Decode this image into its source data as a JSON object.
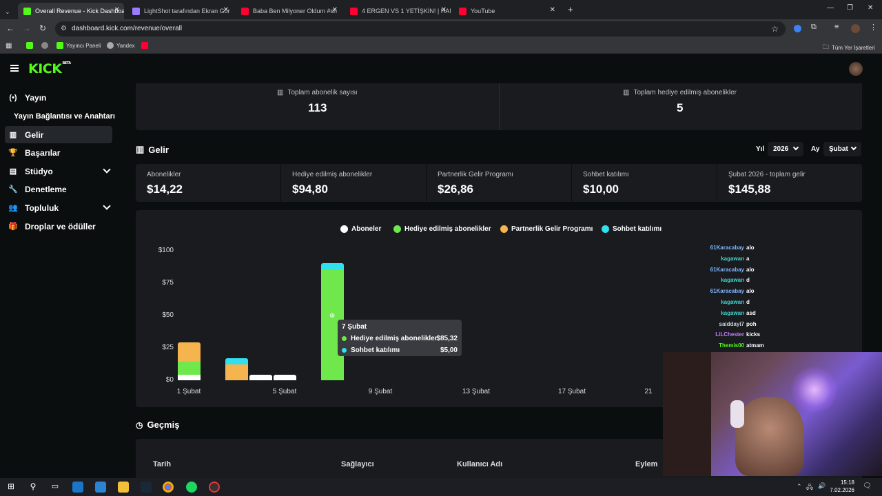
{
  "browser": {
    "tabs": [
      {
        "title": "Overall Revenue - Kick Dashboa",
        "active": true
      },
      {
        "title": "LightShot tarafından Ekran Gör",
        "active": false
      },
      {
        "title": "Baba Ben Milyoner Oldum #sh",
        "active": false
      },
      {
        "title": "4 ERGEN VS 1 YETİŞKİN! | HANİ",
        "active": false
      },
      {
        "title": "YouTube",
        "active": false
      }
    ],
    "url": "dashboard.kick.com/revenue/overall",
    "bookmarks": [
      "Yayıncı Paneli",
      "Yandex"
    ],
    "all_bookmarks_label": "Tüm Yer İşaretleri"
  },
  "sidebar": {
    "items": [
      {
        "label": "Yayın",
        "icon": "broadcast-icon"
      },
      {
        "label": "Yayın Bağlantısı ve Anahtarı",
        "icon": ""
      },
      {
        "label": "Gelir",
        "icon": "chart-icon",
        "active": true
      },
      {
        "label": "Başarılar",
        "icon": "trophy-icon"
      },
      {
        "label": "Stüdyo",
        "icon": "studio-icon",
        "expandable": true
      },
      {
        "label": "Denetleme",
        "icon": "wrench-icon"
      },
      {
        "label": "Topluluk",
        "icon": "people-icon",
        "expandable": true
      },
      {
        "label": "Droplar ve ödüller",
        "icon": "gift-icon"
      }
    ]
  },
  "summary": {
    "total_subs_label": "Toplam abonelik sayısı",
    "total_subs_value": "113",
    "total_gifted_label": "Toplam hediye edilmiş abonelikler",
    "total_gifted_value": "5"
  },
  "revenue": {
    "title": "Gelir",
    "year_label": "Yıl",
    "year_value": "2026",
    "month_label": "Ay",
    "month_value": "Şubat",
    "kpis": [
      {
        "label": "Abonelikler",
        "value": "$14,22"
      },
      {
        "label": "Hediye edilmiş abonelikler",
        "value": "$94,80"
      },
      {
        "label": "Partnerlik Gelir Programı",
        "value": "$26,86"
      },
      {
        "label": "Sohbet katılımı",
        "value": "$10,00"
      },
      {
        "label": "Şubat 2026 - toplam gelir",
        "value": "$145,88"
      }
    ]
  },
  "chart_data": {
    "type": "bar",
    "stacked": true,
    "y_ticks": [
      "$100",
      "$75",
      "$50",
      "$25",
      "$0"
    ],
    "ylim": [
      0,
      100
    ],
    "x_tick_labels": [
      "1 Şubat",
      "5 Şubat",
      "9 Şubat",
      "13 Şubat",
      "17 Şubat",
      "21"
    ],
    "categories": [
      "1 Şubat",
      "3 Şubat",
      "4 Şubat",
      "5 Şubat",
      "7 Şubat"
    ],
    "series": [
      {
        "name": "Aboneler",
        "color": "#ffffff",
        "values": [
          4.5,
          0,
          4.5,
          4.5,
          0
        ]
      },
      {
        "name": "Hediye edilmiş abonelikler",
        "color": "#6ee84a",
        "values": [
          10,
          0,
          0,
          0,
          85.32
        ]
      },
      {
        "name": "Partnerlik Gelir Programı",
        "color": "#f5b44d",
        "values": [
          15,
          12,
          0,
          0,
          0
        ]
      },
      {
        "name": "Sohbet katılımı",
        "color": "#31e0ee",
        "values": [
          0,
          5,
          0,
          0,
          5.0
        ]
      }
    ],
    "tooltip": {
      "title": "7 Şubat",
      "rows": [
        {
          "label": "Hediye edilmiş abonelikler",
          "value": "$85,32"
        },
        {
          "label": "Sohbet katılımı",
          "value": "$5,00"
        }
      ]
    }
  },
  "chat_overlay": [
    {
      "user": "61Karacabay",
      "msg": "alo",
      "color": "#7fb5ff"
    },
    {
      "user": "kagawan",
      "msg": "a",
      "color": "#3fd6d0"
    },
    {
      "user": "61Karacabay",
      "msg": "alo",
      "color": "#7fb5ff"
    },
    {
      "user": "kagawan",
      "msg": "d",
      "color": "#3fd6d0"
    },
    {
      "user": "61Karacabay",
      "msg": "alo",
      "color": "#7fb5ff"
    },
    {
      "user": "kagawan",
      "msg": "d",
      "color": "#3fd6d0"
    },
    {
      "user": "kagawan",
      "msg": "asd",
      "color": "#3fd6d0"
    },
    {
      "user": "saiddayi7",
      "msg": "poh",
      "color": "#c7d1d9"
    },
    {
      "user": "LiLChester",
      "msg": "kicks",
      "color": "#c77dff"
    },
    {
      "user": "Themis00",
      "msg": "atmam",
      "color": "#53fc18"
    }
  ],
  "history": {
    "title": "Geçmiş",
    "columns": [
      "Tarih",
      "Sağlayıcı",
      "Kullanıcı Adı",
      "Eylem"
    ]
  },
  "taskbar": {
    "time": "15:18",
    "date": "7.02.2026"
  }
}
